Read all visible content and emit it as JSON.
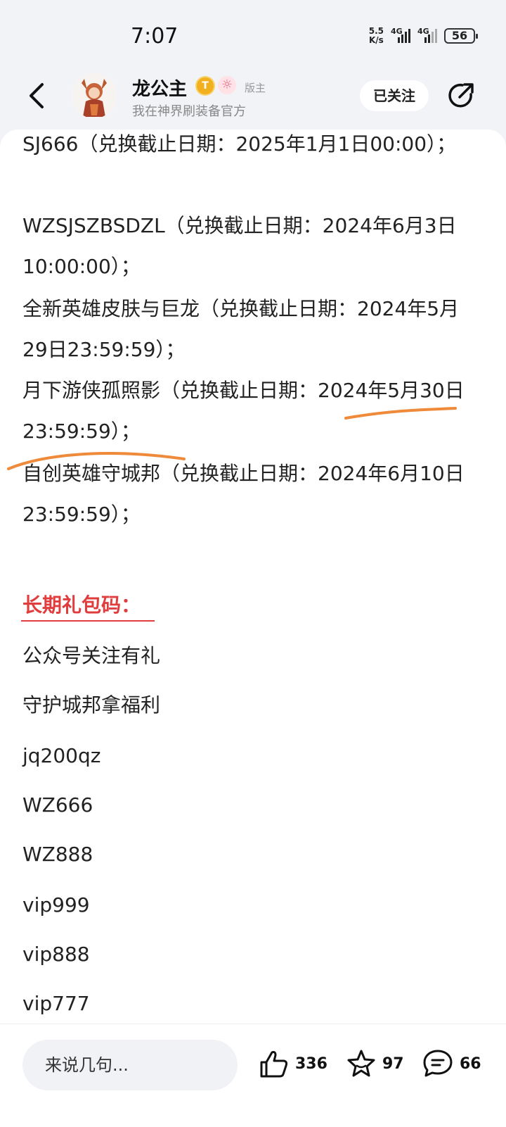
{
  "status_bar": {
    "time": "7:07",
    "net_speed_value": "5.5",
    "net_speed_unit": "K/s",
    "sim1": "4G",
    "sim2": "4G",
    "battery": "56"
  },
  "header": {
    "username": "龙公主",
    "badge_letter": "T",
    "role": "版主",
    "subtitle": "我在神界刷装备官方",
    "follow_label": "已关注"
  },
  "post": {
    "lines": [
      "SJ666（兑换截止日期：2025年1月1日00:00）；",
      "WZSJSZBSDZL（兑换截止日期：2024年6月3日10:00:00）；",
      "全新英雄皮肤与巨龙（兑换截止日期：2024年5月29日23:59:59）；",
      "月下游侠孤照影（兑换截止日期：2024年5月30日23:59:59）；",
      "自创英雄守城邦（兑换截止日期：2024年6月10日23:59:59）；"
    ],
    "section_title": "长期礼包码：",
    "codes": [
      "公众号关注有礼",
      "守护城邦拿福利",
      "jq200qz",
      "WZ666",
      "WZ888",
      "vip999",
      "vip888",
      "vip777"
    ]
  },
  "bottom_bar": {
    "comment_placeholder": "来说几句...",
    "likes": "336",
    "favorites": "97",
    "comments": "66"
  },
  "colors": {
    "accent_red": "#e03e3e",
    "annotation_orange": "#ee8a3a"
  }
}
